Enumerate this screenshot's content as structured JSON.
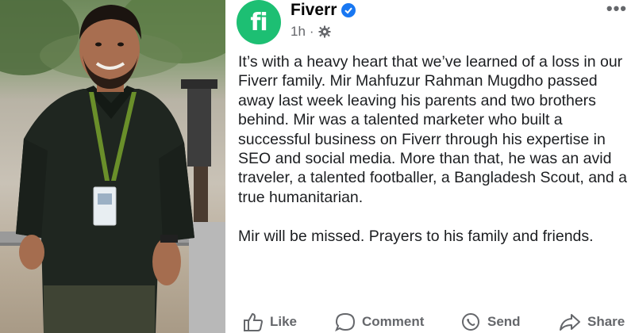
{
  "post": {
    "page_name": "Fiverr",
    "avatar_letters": "fi",
    "time": "1h",
    "separator": "·",
    "more_label": "•••",
    "paragraphs": [
      "It’s with a heavy heart that we’ve learned of a loss in our Fiverr family. Mir Mahfuzur Rahman Mugdho passed away last week leaving his parents and two brothers behind. Mir was a talented marketer who built a successful business on Fiverr through his expertise in SEO and social media. More than that, he was an avid traveler, a talented footballer, a Bangladesh Scout, and a true humanitarian.",
      "Mir will be missed. Prayers to his family and friends."
    ]
  },
  "actions": {
    "like": "Like",
    "comment": "Comment",
    "send": "Send",
    "share": "Share"
  },
  "colors": {
    "brand_green": "#1dbf73",
    "verified_blue": "#1877f2",
    "meta_gray": "#65676b"
  },
  "icons": [
    "verified-badge-icon",
    "gear-icon",
    "more-options-icon",
    "like-icon",
    "comment-icon",
    "send-icon",
    "share-icon"
  ]
}
